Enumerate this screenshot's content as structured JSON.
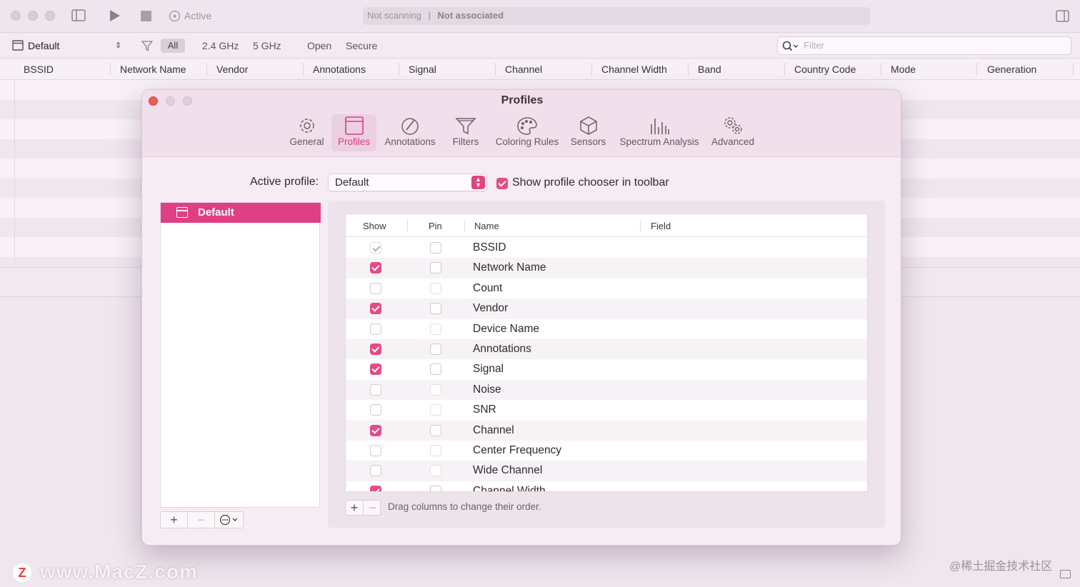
{
  "titlebar": {
    "active_label": "Active",
    "status_left": "Not scanning",
    "status_sep": "|",
    "status_right": "Not associated"
  },
  "toolbar": {
    "profile": "Default",
    "seg_all": "All",
    "band_24": "2.4 GHz",
    "band_5": "5 GHz",
    "open": "Open",
    "secure": "Secure",
    "filter_placeholder": "Filter"
  },
  "columns": [
    "BSSID",
    "Network Name",
    "Vendor",
    "Annotations",
    "Signal",
    "Channel",
    "Channel Width",
    "Band",
    "Country Code",
    "Mode",
    "Generation"
  ],
  "dialog": {
    "title": "Profiles",
    "tabs": [
      {
        "label": "General",
        "icon": "gear-icon"
      },
      {
        "label": "Profiles",
        "icon": "window-icon"
      },
      {
        "label": "Annotations",
        "icon": "pencil-circle-icon"
      },
      {
        "label": "Filters",
        "icon": "funnel-icon"
      },
      {
        "label": "Coloring Rules",
        "icon": "palette-icon"
      },
      {
        "label": "Sensors",
        "icon": "cube-icon"
      },
      {
        "label": "Spectrum Analysis",
        "icon": "bars-icon"
      },
      {
        "label": "Advanced",
        "icon": "gears-icon"
      }
    ],
    "active_profile_label": "Active profile:",
    "active_profile_value": "Default",
    "show_chooser_label": "Show profile chooser in toolbar",
    "profiles": [
      "Default"
    ],
    "table_headers": {
      "show": "Show",
      "pin": "Pin",
      "name": "Name",
      "field": "Field"
    },
    "fields": [
      {
        "name": "BSSID",
        "show": "locked"
      },
      {
        "name": "Network Name",
        "show": true
      },
      {
        "name": "Count",
        "show": false
      },
      {
        "name": "Vendor",
        "show": true
      },
      {
        "name": "Device Name",
        "show": false
      },
      {
        "name": "Annotations",
        "show": true
      },
      {
        "name": "Signal",
        "show": true
      },
      {
        "name": "Noise",
        "show": false
      },
      {
        "name": "SNR",
        "show": false
      },
      {
        "name": "Channel",
        "show": true
      },
      {
        "name": "Center Frequency",
        "show": false
      },
      {
        "name": "Wide Channel",
        "show": false
      },
      {
        "name": "Channel Width",
        "show": true
      }
    ],
    "drag_hint": "Drag columns to change their order.",
    "accent_color": "#e0447f"
  },
  "watermark": "www.MacZ.com",
  "watermark_logo": "Z",
  "credit": "@稀土掘金技术社区"
}
